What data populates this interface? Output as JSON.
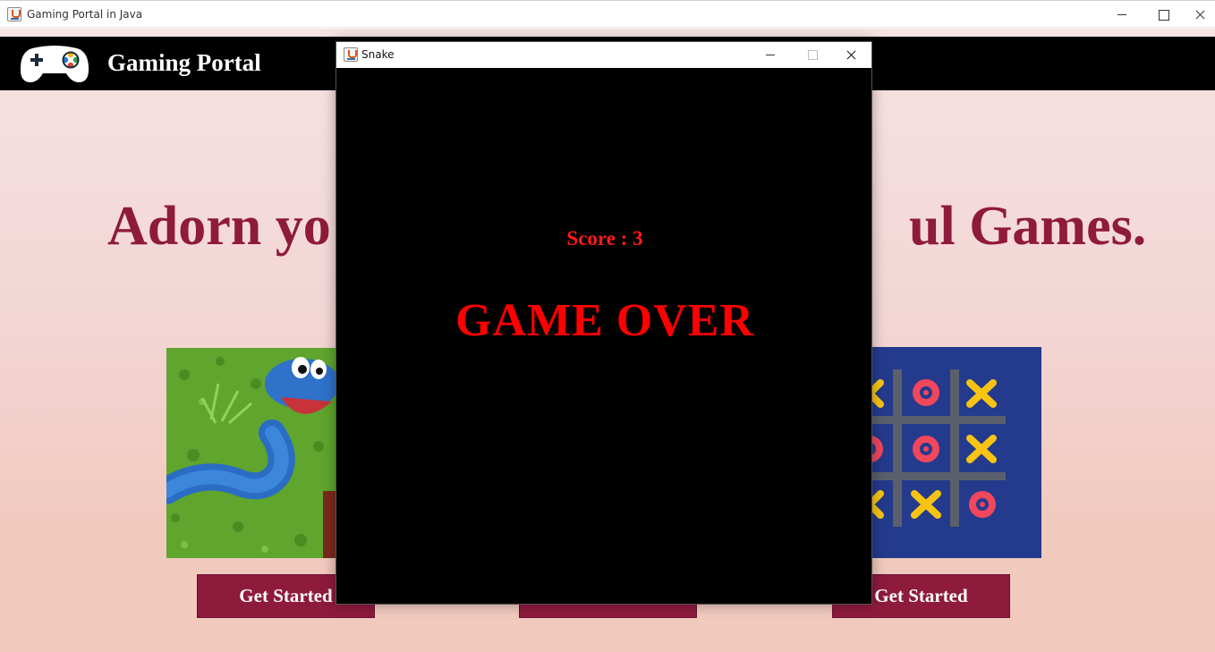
{
  "window": {
    "title": "Gaming Portal in Java"
  },
  "header": {
    "brand": "Gaming Portal",
    "logo_icon": "gamepad-icon"
  },
  "hero": {
    "headline_left": "Adorn yo",
    "headline_right": "ul Games."
  },
  "cards": [
    {
      "image": "snake-game-image",
      "button_label": "Get Started"
    },
    {
      "image": "hidden",
      "button_label": ""
    },
    {
      "image": "tic-tac-toe-image",
      "button_label": "Get Started"
    }
  ],
  "popup": {
    "title": "Snake",
    "score_text": "Score : 3",
    "status_text": "GAME OVER"
  },
  "colors": {
    "accent": "#8e1a3c",
    "header_bg": "#000000",
    "game_text": "#ff0000",
    "ttt_bg": "#243a8c",
    "ttt_x": "#f7c414",
    "ttt_o": "#f0475d"
  }
}
